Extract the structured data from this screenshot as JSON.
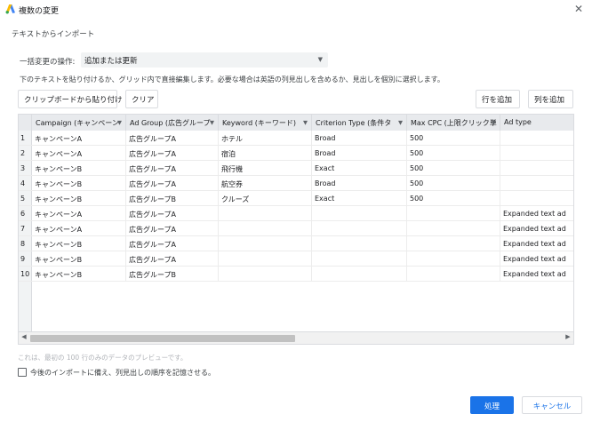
{
  "window": {
    "title": "複数の変更",
    "close_glyph": "✕"
  },
  "subtitle": "テキストからインポート",
  "operation": {
    "label": "一括変更の操作:",
    "value": "追加または更新"
  },
  "instruction": "下のテキストを貼り付けるか、グリッド内で直接編集します。必要な場合は英語の列見出しを含めるか、見出しを個別に選択します。",
  "toolbar": {
    "paste_label": "クリップボードから貼り付け",
    "clear_label": "クリア",
    "add_row_label": "行を追加",
    "add_col_label": "列を追加"
  },
  "grid": {
    "columns": [
      "Campaign (キャンペーン",
      "Ad Group (広告グループ",
      "Keyword (キーワード)",
      "Criterion Type (条件タ",
      "Max CPC (上限クリック単",
      "Ad type"
    ],
    "rows": [
      {
        "n": "1",
        "c": [
          "キャンペーンA",
          "広告グループA",
          "ホテル",
          "Broad",
          "500",
          ""
        ]
      },
      {
        "n": "2",
        "c": [
          "キャンペーンA",
          "広告グループA",
          "宿泊",
          "Broad",
          "500",
          ""
        ]
      },
      {
        "n": "3",
        "c": [
          "キャンペーンB",
          "広告グループA",
          "飛行機",
          "Exact",
          "500",
          ""
        ]
      },
      {
        "n": "4",
        "c": [
          "キャンペーンB",
          "広告グループA",
          "航空券",
          "Broad",
          "500",
          ""
        ]
      },
      {
        "n": "5",
        "c": [
          "キャンペーンB",
          "広告グループB",
          "クルーズ",
          "Exact",
          "500",
          ""
        ]
      },
      {
        "n": "6",
        "c": [
          "キャンペーンA",
          "広告グループA",
          "",
          "",
          "",
          "Expanded text ad"
        ]
      },
      {
        "n": "7",
        "c": [
          "キャンペーンA",
          "広告グループA",
          "",
          "",
          "",
          "Expanded text ad"
        ]
      },
      {
        "n": "8",
        "c": [
          "キャンペーンB",
          "広告グループA",
          "",
          "",
          "",
          "Expanded text ad"
        ]
      },
      {
        "n": "9",
        "c": [
          "キャンペーンB",
          "広告グループA",
          "",
          "",
          "",
          "Expanded text ad"
        ]
      },
      {
        "n": "10",
        "c": [
          "キャンペーンB",
          "広告グループB",
          "",
          "",
          "",
          "Expanded text ad"
        ]
      }
    ]
  },
  "preview_note": "これは、最初の 100 行のみのデータのプレビューです。",
  "remember_checkbox_label": "今後のインポートに備え、列見出しの順序を記憶させる。",
  "actions": {
    "process_label": "処理",
    "cancel_label": "キャンセル"
  },
  "icons": {
    "logo": "google-ads-logo-icon",
    "close": "close-icon",
    "dropdown": "chevron-down-icon",
    "scroll_left": "scroll-left-icon",
    "scroll_right": "scroll-right-icon"
  },
  "colors": {
    "primary": "#1a73e8",
    "header_bg": "#e8eaed",
    "border": "#dadce0"
  }
}
